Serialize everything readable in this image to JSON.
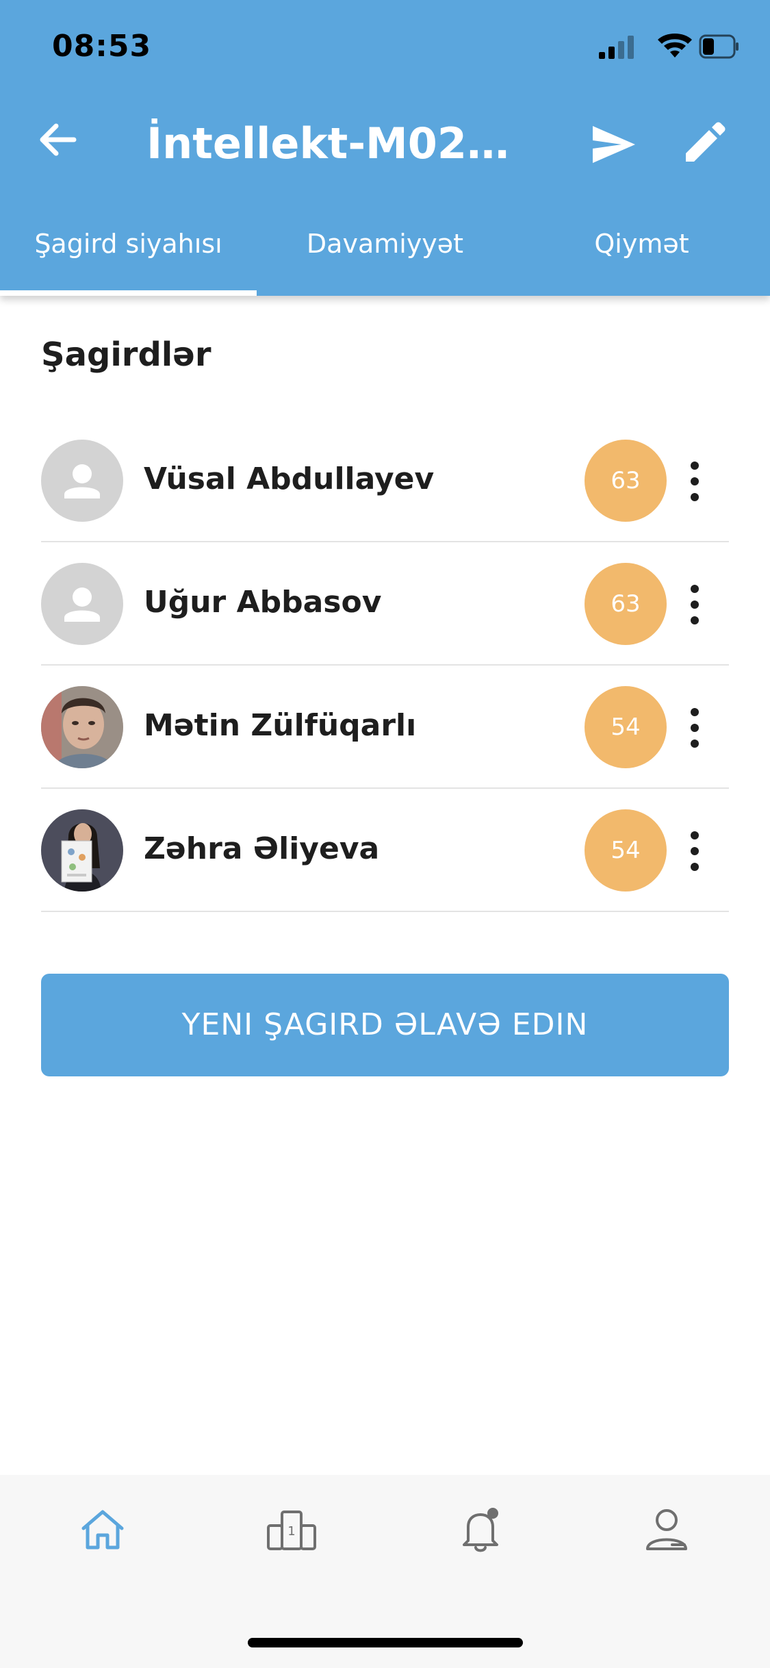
{
  "status_bar": {
    "time": "08:53",
    "icons": [
      "cellular-signal-icon",
      "wifi-icon",
      "battery-icon"
    ]
  },
  "app_bar": {
    "title": "İntellekt-M02-0...",
    "icons": [
      "back-arrow-icon",
      "send-icon",
      "edit-pencil-icon"
    ]
  },
  "tabs": [
    {
      "label": "Şagird siyahısı",
      "active": true
    },
    {
      "label": "Davamiyyət",
      "active": false
    },
    {
      "label": "Qiymət",
      "active": false
    }
  ],
  "section_title": "Şagirdlər",
  "students": [
    {
      "name": "Vüsal Abdullayev",
      "score": "63",
      "avatar": "placeholder"
    },
    {
      "name": "Uğur Abbasov",
      "score": "63",
      "avatar": "placeholder"
    },
    {
      "name": "Mətin Zülfüqarlı",
      "score": "54",
      "avatar": "photo"
    },
    {
      "name": "Zəhra Əliyeva",
      "score": "54",
      "avatar": "photo"
    }
  ],
  "add_button_label": "YENI ŞAGIRD ƏLAVƏ EDIN",
  "bottom_nav": {
    "items": [
      "home-icon",
      "leaderboard-icon",
      "notifications-bell-icon",
      "profile-icon"
    ],
    "active": "home-icon",
    "leaderboard_badge": "1"
  },
  "colors": {
    "primary": "#5ba6dd",
    "score_badge": "#f2b96c",
    "placeholder_avatar": "#d3d3d3",
    "nav_active": "#5ba6dd",
    "nav_inactive": "#6f6f6f"
  }
}
